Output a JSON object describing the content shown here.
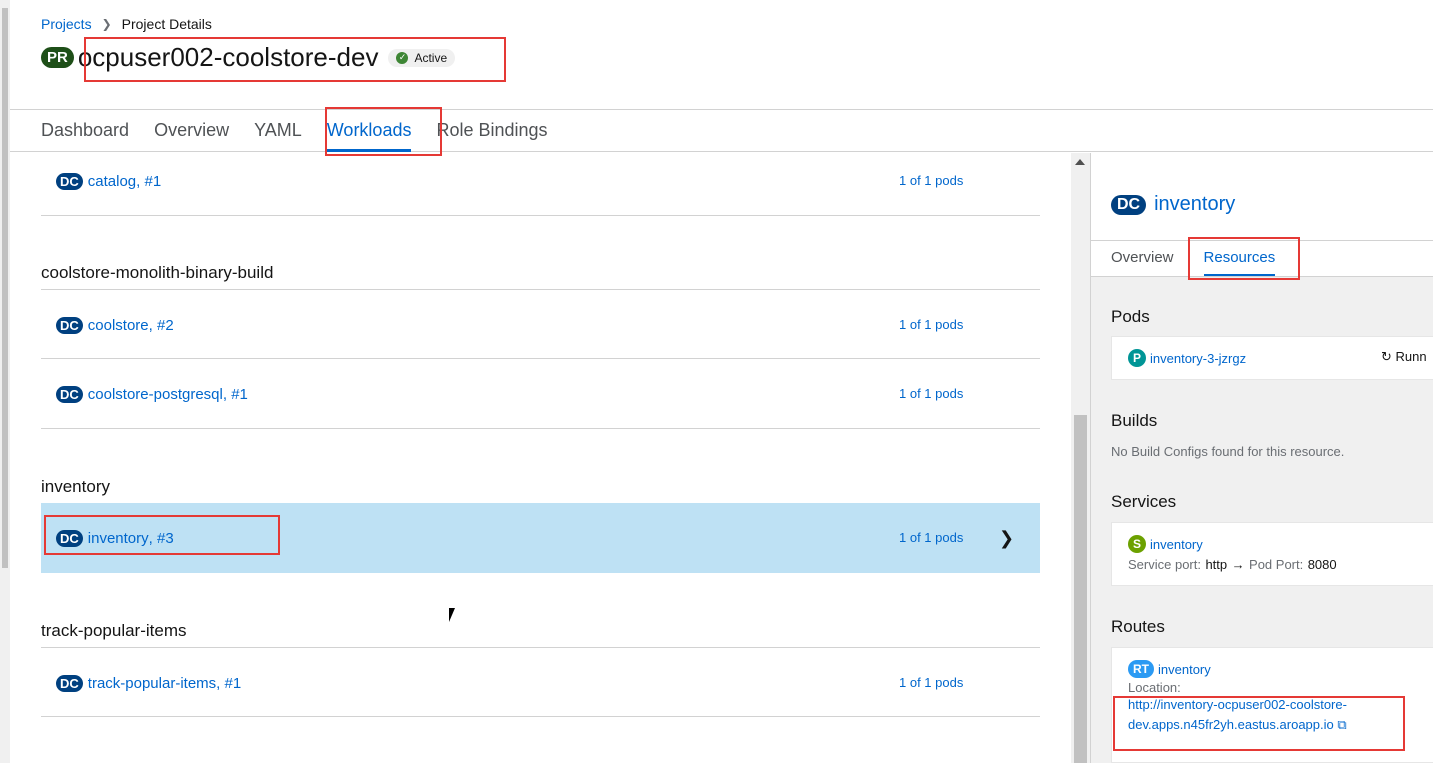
{
  "breadcrumb": {
    "projects": "Projects",
    "current": "Project Details"
  },
  "project": {
    "badge": "PR",
    "name": "ocpuser002-coolstore-dev",
    "status": "Active"
  },
  "tabs": [
    "Dashboard",
    "Overview",
    "YAML",
    "Workloads",
    "Role Bindings"
  ],
  "active_tab": "Workloads",
  "workloads": {
    "catalog": {
      "badge": "DC",
      "name": "catalog",
      "rev": ", #1",
      "pods": "1 of 1 pods"
    },
    "groups": [
      {
        "title": "coolstore-monolith-binary-build",
        "items": [
          {
            "badge": "DC",
            "name": "coolstore",
            "rev": ", #2",
            "pods": "1 of 1 pods"
          },
          {
            "badge": "DC",
            "name": "coolstore-postgresql",
            "rev": ", #1",
            "pods": "1 of 1 pods"
          }
        ]
      },
      {
        "title": "inventory",
        "items": [
          {
            "badge": "DC",
            "name": "inventory",
            "rev": ", #3",
            "pods": "1 of 1 pods",
            "selected": true
          }
        ]
      },
      {
        "title": "track-popular-items",
        "items": [
          {
            "badge": "DC",
            "name": "track-popular-items",
            "rev": ", #1",
            "pods": "1 of 1 pods"
          }
        ]
      }
    ]
  },
  "side": {
    "badge": "DC",
    "title": "inventory",
    "tabs": [
      "Overview",
      "Resources"
    ],
    "active_tab": "Resources",
    "pods": {
      "heading": "Pods",
      "badge": "P",
      "name": "inventory-3-jzrgz",
      "status": "Runn"
    },
    "builds": {
      "heading": "Builds",
      "empty": "No Build Configs found for this resource."
    },
    "services": {
      "heading": "Services",
      "badge": "S",
      "name": "inventory",
      "service_port_label": "Service port:",
      "service_port": "http",
      "pod_port_label": "Pod Port:",
      "pod_port": "8080"
    },
    "routes": {
      "heading": "Routes",
      "badge": "RT",
      "name": "inventory",
      "location_label": "Location:",
      "url_line1": "http://inventory-ocpuser002-coolstore-",
      "url_line2": "dev.apps.n45fr2yh.eastus.aroapp.io"
    }
  },
  "colors": {
    "link": "#0066cc",
    "selected_row": "#bee1f4",
    "highlight": "#e53935",
    "pr_badge": "#1e4f18",
    "dc_badge": "#004080"
  }
}
